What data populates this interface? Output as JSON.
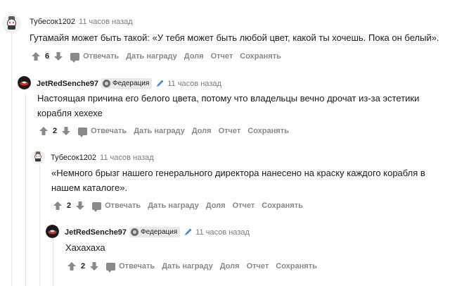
{
  "comments": [
    {
      "author": "Тубесок1202",
      "time": "11 часов назад",
      "text": "Гутамайя может быть такой: «У тебя может быть любой цвет, какой ты хочешь. Пока он белый».",
      "score": "6"
    },
    {
      "author": "JetRedSenche97",
      "flair": "Федерация",
      "time": "11 часов назад",
      "text_lines": [
        "Настоящая причина его белого цвета, потому что владельцы вечно дрочат из-за эстетики",
        "корабля хехехе"
      ],
      "score": "2"
    },
    {
      "author": "Тубесок1202",
      "time": "11 часов назад",
      "text_lines": [
        "«Немного брызг нашего генерального директора нанесено на краску каждого корабля в",
        "нашем каталоге»."
      ],
      "score": "2"
    },
    {
      "author": "JetRedSenche97",
      "flair": "Федерация",
      "time": "11 часов назад",
      "text": "Хахахаха",
      "score": "2"
    }
  ],
  "actions": {
    "reply": "Отвечать",
    "award": "Дать награду",
    "share": "Доля",
    "report": "Отчет",
    "save": "Сохранять"
  },
  "colors": {
    "upvote": "#878a8c",
    "action_text": "#878a8c",
    "time": "#7c7c7c",
    "mod_icon": "#4a90d9"
  }
}
